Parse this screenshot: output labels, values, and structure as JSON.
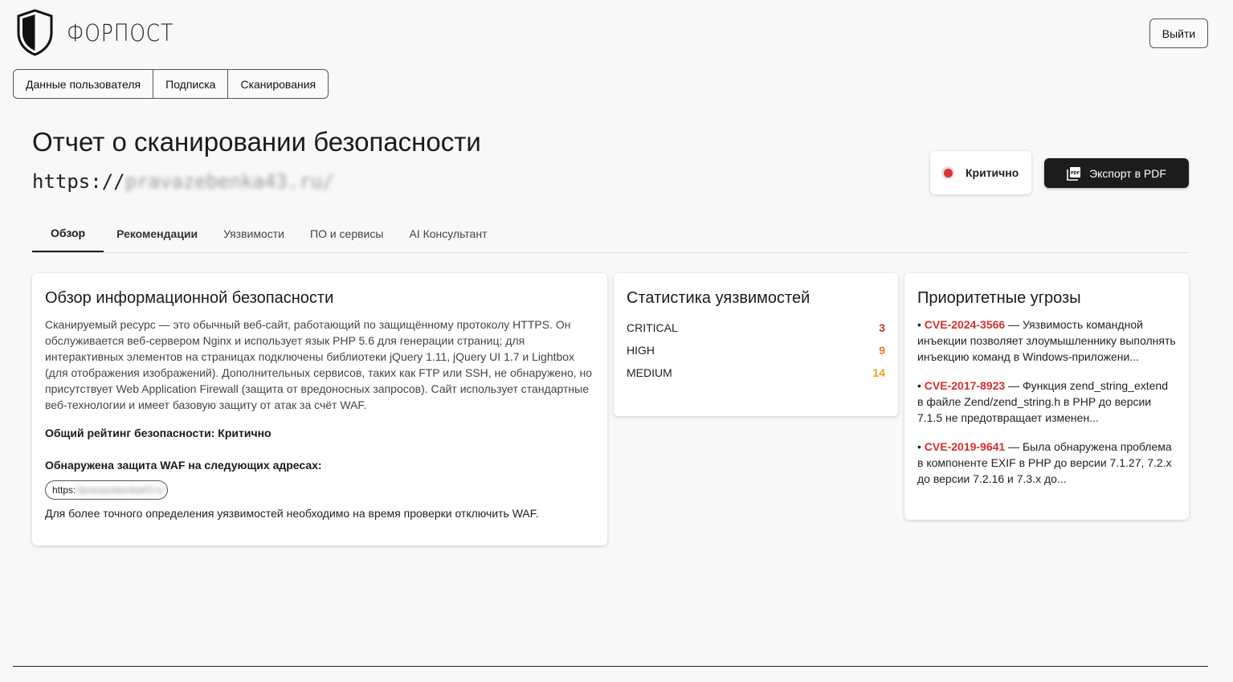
{
  "brand": {
    "name": "ФОРПОСТ"
  },
  "header": {
    "logout_label": "Выйти"
  },
  "topnav": {
    "items": [
      "Данные пользователя",
      "Подписка",
      "Сканирования"
    ]
  },
  "report": {
    "title": "Отчет о сканировании безопасности",
    "url_prefix": "https://",
    "url_masked": "pravazebenka43.ru/"
  },
  "status": {
    "label": "Критично",
    "color": "#e03030"
  },
  "export": {
    "label": "Экспорт в PDF"
  },
  "tabs": [
    "Обзор",
    "Рекомендации",
    "Уязвимости",
    "ПО и сервисы",
    "AI Консультант"
  ],
  "overview": {
    "title": "Обзор информационной безопасности",
    "text": "Сканируемый ресурс — это обычный веб-сайт, работающий по защищённому протоколу HTTPS. Он обслуживается веб-сервером Nginx и использует язык PHP 5.6 для генерации страниц; для интерактивных элементов на страницах подключены библиотеки jQuery 1.11, jQuery UI 1.7 и Lightbox (для отображения изображений). Дополнительных сервисов, таких как FTP или SSH, не обнаружено, но присутствует Web Application Firewall (защита от вредоносных запросов). Сайт использует стандартные веб-технологии и имеет базовую защиту от атак за счёт WAF.",
    "rating": "Общий рейтинг безопасности: Критично",
    "waf_title": "Обнаружена защита WAF на следующих адресах:",
    "waf_url_prefix": "https:",
    "waf_url_masked": "//pravazebenka43.ru",
    "waf_note": "Для более точного определения уязвимостей необходимо на время проверки отключить WAF."
  },
  "stats": {
    "title": "Статистика уязвимостей",
    "rows": [
      {
        "label": "CRITICAL",
        "value": "3",
        "color": "#d32f2f"
      },
      {
        "label": "HIGH",
        "value": "9",
        "color": "#e67e22"
      },
      {
        "label": "MEDIUM",
        "value": "14",
        "color": "#f0a020"
      }
    ]
  },
  "threats": {
    "title": "Приоритетные угрозы",
    "items": [
      {
        "cve": "CVE-2024-3566",
        "desc": " — Уязвимость командной инъекции позволяет злоумышленнику выполнять инъекцию команд в Windows-приложени..."
      },
      {
        "cve": "CVE-2017-8923",
        "desc": " — Функция zend_string_extend в файле Zend/zend_string.h в PHP до версии 7.1.5 не предотвращает изменен..."
      },
      {
        "cve": "CVE-2019-9641",
        "desc": " — Была обнаружена проблема в компоненте EXIF в PHP до версии 7.1.27, 7.2.x до версии 7.2.16 и 7.3.x до..."
      }
    ]
  }
}
